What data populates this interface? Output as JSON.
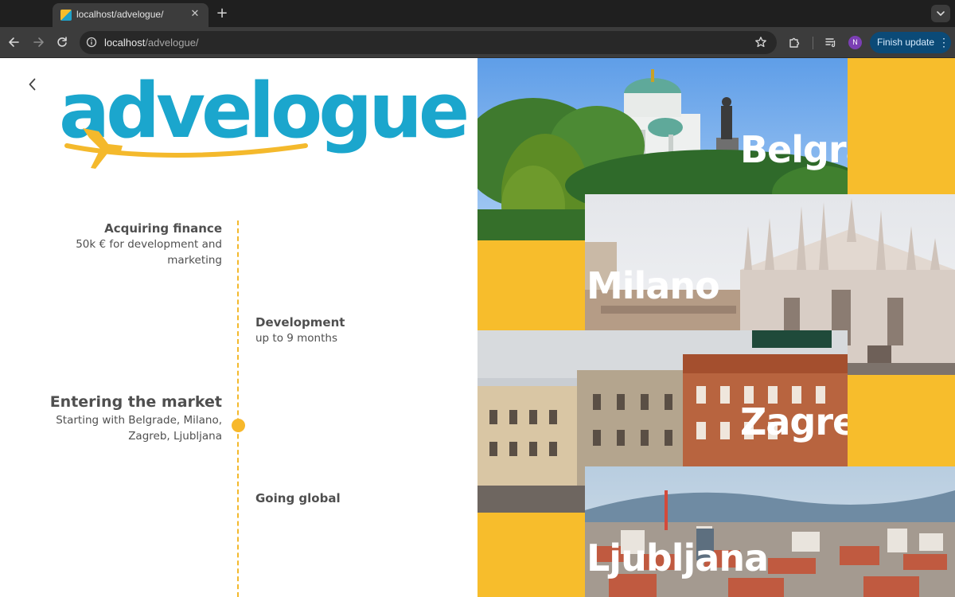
{
  "browser": {
    "tab_title": "localhost/advelogue/",
    "url_host": "localhost",
    "url_path": "/advelogue/",
    "profile_initial": "N",
    "finish_update_label": "Finish update",
    "profile_color": "#7b3fb4"
  },
  "brand": {
    "logo_text": "advelogue",
    "logo_color": "#1ba6cd",
    "accent_color": "#f7bd2c"
  },
  "timeline": {
    "items": [
      {
        "title": "Acquiring finance",
        "subtitle_line1": "50k € for development and",
        "subtitle_line2": "marketing"
      },
      {
        "title": "Development",
        "subtitle_line1": "up to 9 months"
      },
      {
        "title": "Entering the market",
        "subtitle_line1": "Starting with Belgrade, Milano,",
        "subtitle_line2": "Zagreb, Ljubljana"
      },
      {
        "title": "Going global"
      }
    ]
  },
  "cities": [
    {
      "name": "Belgrade"
    },
    {
      "name": "Milano"
    },
    {
      "name": "Zagreb"
    },
    {
      "name": "Ljubljana"
    }
  ]
}
